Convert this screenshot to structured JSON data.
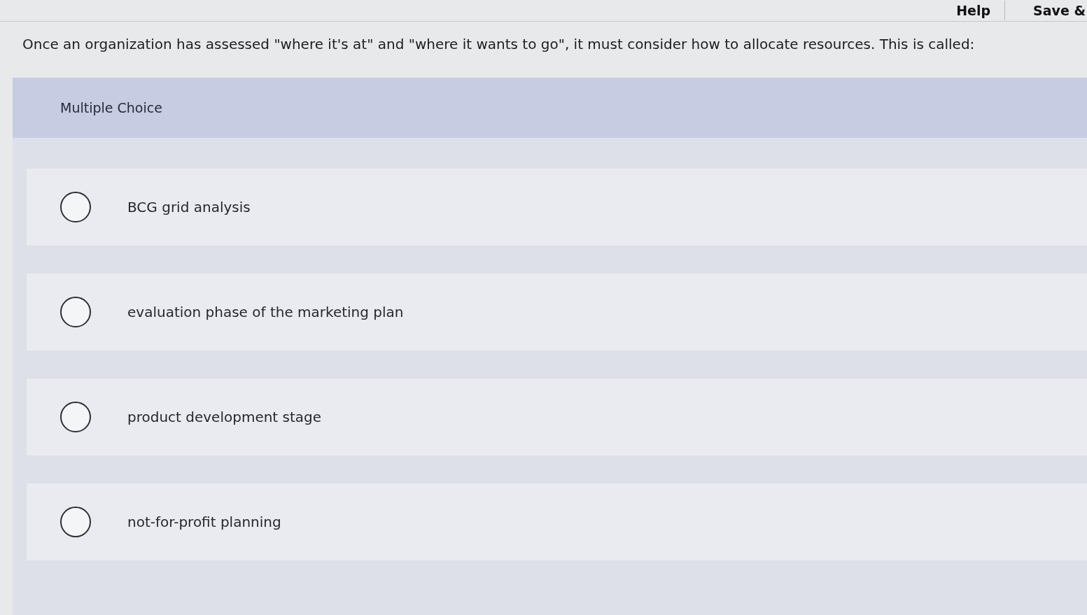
{
  "header": {
    "links": [
      {
        "label": "Help"
      },
      {
        "label": "Save &"
      }
    ]
  },
  "question": {
    "text": "Once an organization has assessed \"where it's at\" and \"where it wants to go\", it must consider how to allocate resources. This is called:"
  },
  "panel": {
    "title": "Multiple Choice"
  },
  "options": [
    {
      "label": "BCG grid analysis",
      "selected": false
    },
    {
      "label": "evaluation phase of the marketing plan",
      "selected": false
    },
    {
      "label": "product development stage",
      "selected": false
    },
    {
      "label": "not-for-profit planning",
      "selected": false
    }
  ]
}
